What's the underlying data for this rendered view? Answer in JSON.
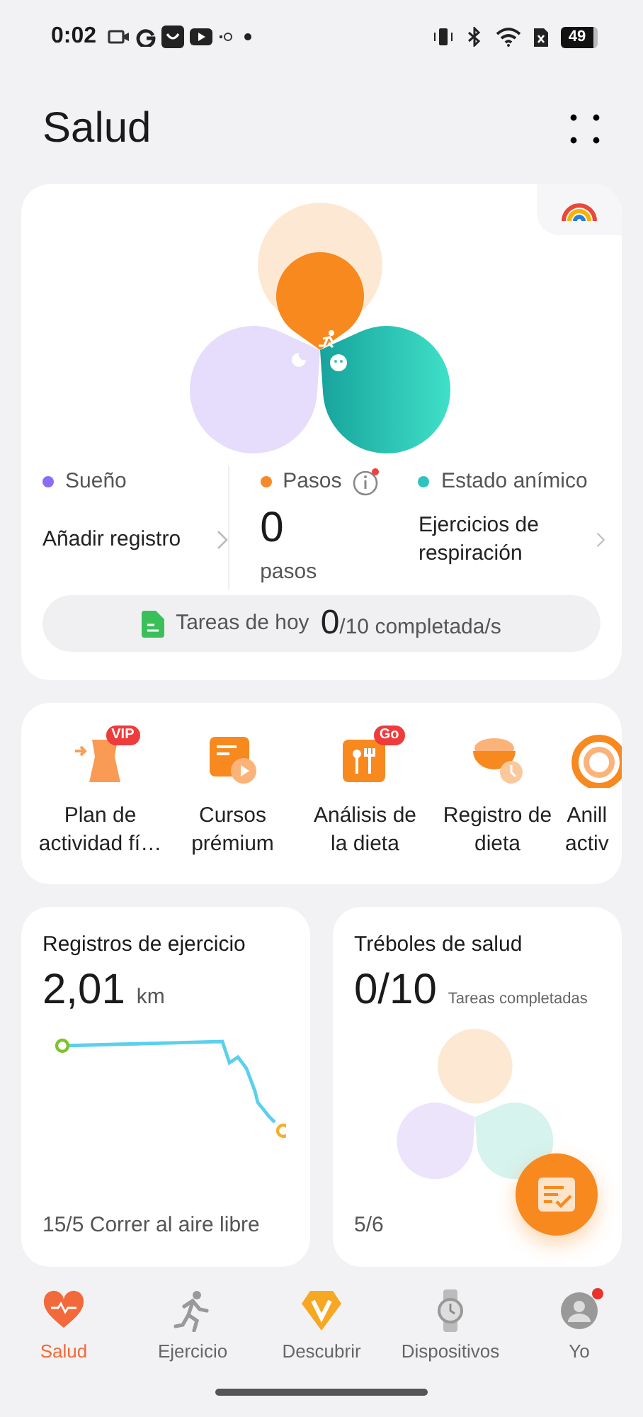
{
  "status_bar": {
    "time": "0:02",
    "battery": "49"
  },
  "header": {
    "title": "Salud"
  },
  "summary": {
    "metrics": [
      {
        "kind": "link",
        "label": "Sueño",
        "color": "#8b6cf6",
        "value": "Añadir registro"
      },
      {
        "kind": "count",
        "label": "Pasos",
        "color": "#f7892b",
        "value": "0",
        "unit": "pasos"
      },
      {
        "kind": "link",
        "label": "Estado anímico",
        "color": "#2cc3c0",
        "value": "Ejercicios de respiración"
      }
    ],
    "tasks": {
      "label": "Tareas de hoy",
      "done": "0",
      "total": "/10 completada/s"
    }
  },
  "shortcuts": [
    {
      "lines": [
        "Plan de",
        "actividad fí…"
      ],
      "badge": "VIP",
      "kind": "body"
    },
    {
      "lines": [
        "Cursos",
        "prémium"
      ],
      "kind": "course"
    },
    {
      "lines": [
        "Análisis de",
        "la dieta"
      ],
      "badge": "Go",
      "kind": "diet"
    },
    {
      "lines": [
        "Registro de",
        "dieta"
      ],
      "kind": "bowl"
    },
    {
      "lines": [
        "Anill",
        "activ"
      ],
      "kind": "ring"
    }
  ],
  "exercise": {
    "title": "Registros de ejercicio",
    "distance": "2,01",
    "unit": "km",
    "footer": "15/5 Correr al aire libre"
  },
  "clovers": {
    "title": "Tréboles de salud",
    "value": "0/10",
    "caption": "Tareas completadas",
    "footer": "5/6"
  },
  "nav": [
    {
      "label": "Salud",
      "selected": true,
      "notification": false,
      "kind": "heart"
    },
    {
      "label": "Ejercicio",
      "selected": false,
      "notification": false,
      "kind": "run"
    },
    {
      "label": "Descubrir",
      "selected": false,
      "notification": false,
      "kind": "gem"
    },
    {
      "label": "Dispositivos",
      "selected": false,
      "notification": false,
      "kind": "watch"
    },
    {
      "label": "Yo",
      "selected": false,
      "notification": true,
      "kind": "avatar"
    }
  ]
}
